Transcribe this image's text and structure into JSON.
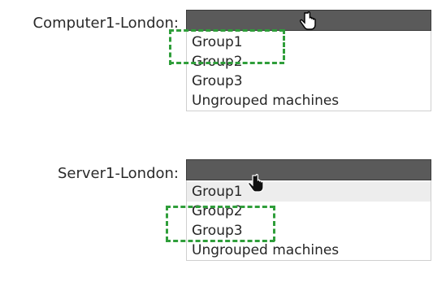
{
  "dropdowns": [
    {
      "label": "Computer1-London:",
      "options": [
        "Group1",
        "Group2",
        "Group3",
        "Ungrouped machines"
      ],
      "highlighted_index": 0
    },
    {
      "label": "Server1-London:",
      "options": [
        "Group1",
        "Group2",
        "Group3",
        "Ungrouped machines"
      ],
      "highlighted_index": 0
    }
  ],
  "colors": {
    "header": "#5a5a5a",
    "annotation": "#2f9e3a",
    "hover": "#ededed"
  },
  "icons": [
    "hand-cursor-icon"
  ]
}
